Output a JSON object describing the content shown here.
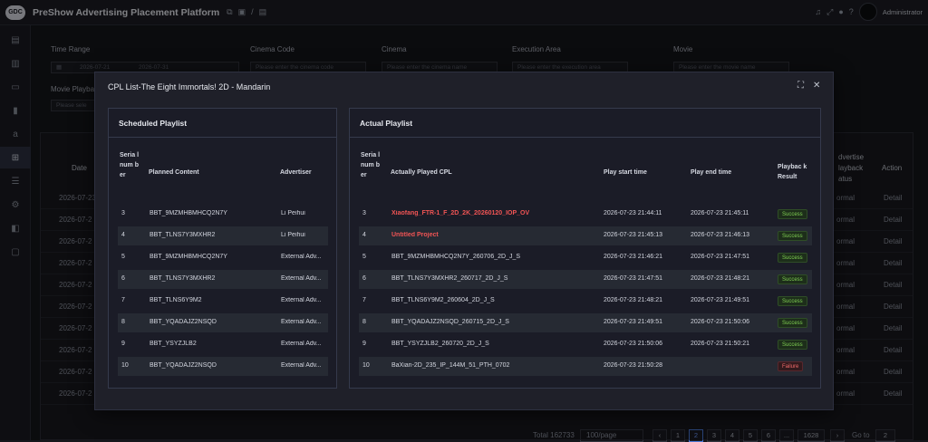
{
  "app": {
    "logo_text": "GDC",
    "title": "PreShow Advertising Placement Platform",
    "user": "Administrator",
    "toolbar_icons": [
      "copy-icon",
      "layers-icon",
      "slash",
      "document-icon"
    ]
  },
  "sidebar": {
    "items": [
      "document-icon",
      "dashboard-icon",
      "screen-icon",
      "chart-icon",
      "amazon-icon",
      "grid-icon",
      "list-icon",
      "gear-icon",
      "box-icon",
      "monitor-icon"
    ],
    "active_index": 5
  },
  "filters": {
    "time_range_label": "Time Range",
    "time_start": "2026-07-21",
    "time_end": "2026-07-31",
    "cinema_code_label": "Cinema Code",
    "cinema_code_placeholder": "Please enter the cinema code",
    "cinema_label": "Cinema",
    "cinema_placeholder": "Please enter the cinema name",
    "execution_area_label": "Execution Area",
    "execution_area_placeholder": "Please enter the execution area",
    "movie_label": "Movie",
    "movie_placeholder": "Please enter the movie name",
    "movie_playback_label": "Movie Playba",
    "movie_playback_placeholder": "Please sele"
  },
  "background_table": {
    "date_header": "Date",
    "advertisement_header": "dvertise",
    "playback_header": "layback",
    "status_header": "atus",
    "action_header": "Action",
    "rows": [
      {
        "date": "2026-07-23",
        "status": "ormal",
        "action": "Detail"
      },
      {
        "date": "2026-07-2",
        "status": "ormal",
        "action": "Detail"
      },
      {
        "date": "2026-07-2",
        "status": "ormal",
        "action": "Detail"
      },
      {
        "date": "2026-07-2",
        "status": "ormal",
        "action": "Detail"
      },
      {
        "date": "2026-07-2",
        "status": "ormal",
        "action": "Detail"
      },
      {
        "date": "2026-07-2",
        "status": "ormal",
        "action": "Detail"
      },
      {
        "date": "2026-07-2",
        "status": "ormal",
        "action": "Detail"
      },
      {
        "date": "2026-07-2",
        "status": "ormal",
        "action": "Detail"
      },
      {
        "date": "2026-07-2",
        "status": "ormal",
        "action": "Detail"
      },
      {
        "date": "2026-07-2",
        "status": "ormal",
        "action": "Detail"
      }
    ]
  },
  "modal": {
    "title": "CPL List-The Eight Immortals! 2D - Mandarin",
    "scheduled": {
      "title": "Scheduled Playlist",
      "headers": {
        "serial": "Seria l num ber",
        "planned": "Planned Content",
        "advertiser": "Advertiser"
      },
      "rows": [
        {
          "serial": "3",
          "planned": "BBT_9MZMHBMHCQ2N7Y",
          "advertiser": "Li Peihui"
        },
        {
          "serial": "4",
          "planned": "BBT_TLNS7Y3MXHR2",
          "advertiser": "Li Peihui"
        },
        {
          "serial": "5",
          "planned": "BBT_9MZMHBMHCQ2N7Y",
          "advertiser": "External Adv..."
        },
        {
          "serial": "6",
          "planned": "BBT_TLNS7Y3MXHR2",
          "advertiser": "External Adv..."
        },
        {
          "serial": "7",
          "planned": "BBT_TLNS6Y9M2",
          "advertiser": "External Adv..."
        },
        {
          "serial": "8",
          "planned": "BBT_YQADAJZ2NSQD",
          "advertiser": "External Adv..."
        },
        {
          "serial": "9",
          "planned": "BBT_YSYZJLB2",
          "advertiser": "External Adv..."
        },
        {
          "serial": "10",
          "planned": "BBT_YQADAJZ2NSQD",
          "advertiser": "External Adv..."
        }
      ]
    },
    "actual": {
      "title": "Actual Playlist",
      "headers": {
        "serial": "Seria l num ber",
        "cpl": "Actually Played CPL",
        "start": "Play start time",
        "end": "Play end time",
        "result": "Playbac k Result"
      },
      "rows": [
        {
          "serial": "3",
          "cpl": "Xiaofang_FTR-1_F_2D_2K_20260120_IOP_OV",
          "start": "2026-07-23 21:44:11",
          "end": "2026-07-23 21:45:11",
          "result": "Success",
          "ok": true,
          "red": true
        },
        {
          "serial": "4",
          "cpl": "Untitled Project",
          "start": "2026-07-23 21:45:13",
          "end": "2026-07-23 21:46:13",
          "result": "Success",
          "ok": true,
          "red": true
        },
        {
          "serial": "5",
          "cpl": "BBT_9MZMHBMHCQ2N7Y_260706_2D_J_S",
          "start": "2026-07-23 21:46:21",
          "end": "2026-07-23 21:47:51",
          "result": "Success",
          "ok": true,
          "red": false
        },
        {
          "serial": "6",
          "cpl": "BBT_TLNS7Y3MXHR2_260717_2D_J_S",
          "start": "2026-07-23 21:47:51",
          "end": "2026-07-23 21:48:21",
          "result": "Success",
          "ok": true,
          "red": false
        },
        {
          "serial": "7",
          "cpl": "BBT_TLNS6Y9M2_260604_2D_J_S",
          "start": "2026-07-23 21:48:21",
          "end": "2026-07-23 21:49:51",
          "result": "Success",
          "ok": true,
          "red": false
        },
        {
          "serial": "8",
          "cpl": "BBT_YQADAJZ2NSQD_260715_2D_J_S",
          "start": "2026-07-23 21:49:51",
          "end": "2026-07-23 21:50:06",
          "result": "Success",
          "ok": true,
          "red": false
        },
        {
          "serial": "9",
          "cpl": "BBT_YSYZJLB2_260720_2D_J_S",
          "start": "2026-07-23 21:50:06",
          "end": "2026-07-23 21:50:21",
          "result": "Success",
          "ok": true,
          "red": false
        },
        {
          "serial": "10",
          "cpl": "BaXian-2D_235_IP_144M_51_PTH_0702",
          "start": "2026-07-23 21:50:28",
          "end": "",
          "result": "Failure",
          "ok": false,
          "red": false
        }
      ]
    }
  },
  "pagination": {
    "total": "Total 162733",
    "page_size": "100/page",
    "pages": [
      "1",
      "2",
      "3",
      "4",
      "5",
      "6",
      "...",
      "1628"
    ],
    "active": "2",
    "goto_label": "Go to",
    "goto_value": "2"
  }
}
